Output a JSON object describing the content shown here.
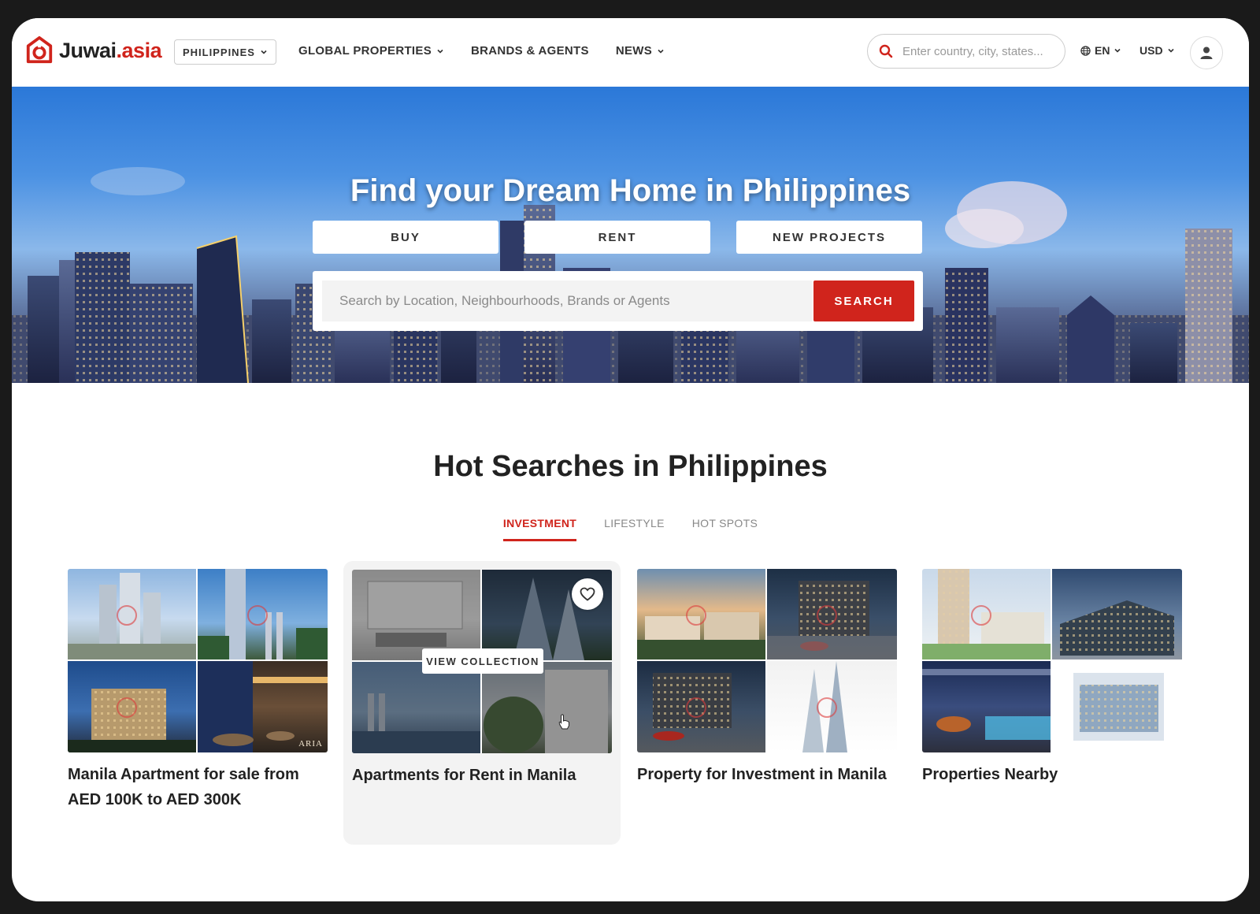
{
  "brand": {
    "name_dark": "Juwai",
    "name_red": ".asia"
  },
  "header": {
    "country": "PHILIPPINES",
    "nav": [
      {
        "label": "GLOBAL PROPERTIES",
        "dropdown": true
      },
      {
        "label": "BRANDS & AGENTS",
        "dropdown": false
      },
      {
        "label": "NEWS",
        "dropdown": true
      }
    ],
    "search_placeholder": "Enter country, city, states...",
    "language": "EN",
    "currency": "USD"
  },
  "hero": {
    "title": "Find your Dream Home in Philippines",
    "tabs": [
      "BUY",
      "RENT",
      "NEW PROJECTS"
    ],
    "search_placeholder": "Search by Location, Neighbourhoods, Brands or Agents",
    "search_button": "SEARCH"
  },
  "hot": {
    "title": "Hot Searches in Philippines",
    "tabs": [
      {
        "label": "INVESTMENT",
        "active": true
      },
      {
        "label": "LIFESTYLE",
        "active": false
      },
      {
        "label": "HOT SPOTS",
        "active": false
      }
    ],
    "cards": [
      {
        "title": "Manila Apartment for sale from AED 100K to AED 300K"
      },
      {
        "title": "Apartments for Rent in Manila",
        "overlay_label": "VIEW COLLECTION"
      },
      {
        "title": "Property for Investment in Manila"
      },
      {
        "title": "Properties Nearby"
      }
    ],
    "tile_caption": "ARIA"
  },
  "colors": {
    "accent": "#d0241c",
    "text": "#222222"
  },
  "icons": [
    "logo-icon",
    "chevron-down-icon",
    "search-icon",
    "globe-icon",
    "user-icon",
    "heart-icon",
    "hand-cursor-icon"
  ]
}
